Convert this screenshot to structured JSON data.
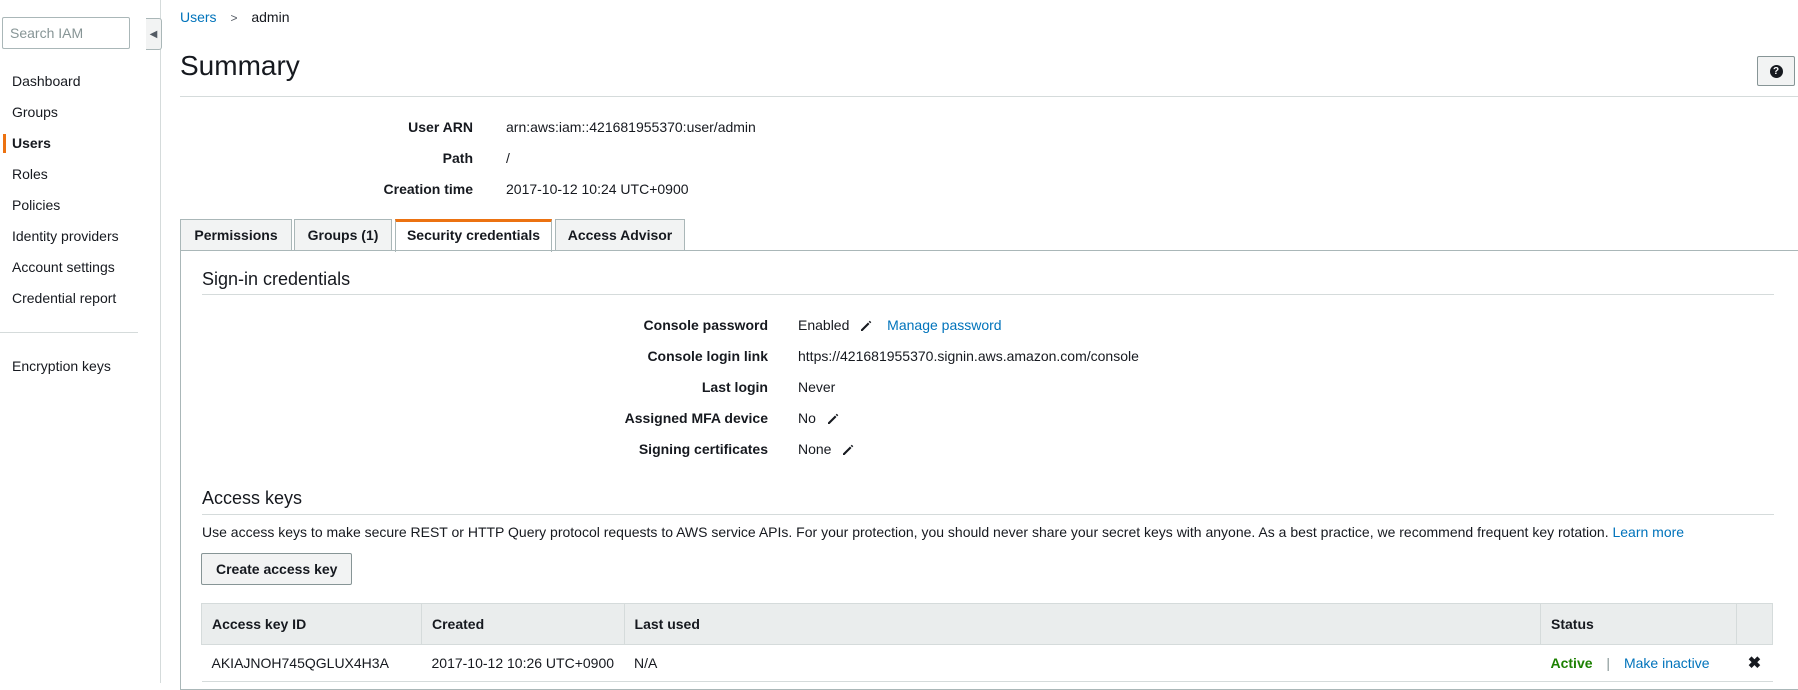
{
  "sidebar": {
    "search_placeholder": "Search IAM",
    "collapse_icon": "caret-left-icon",
    "items": [
      {
        "label": "Dashboard"
      },
      {
        "label": "Groups"
      },
      {
        "label": "Users",
        "active": true
      },
      {
        "label": "Roles"
      },
      {
        "label": "Policies"
      },
      {
        "label": "Identity providers"
      },
      {
        "label": "Account settings"
      },
      {
        "label": "Credential report"
      }
    ],
    "encryption_keys": "Encryption keys"
  },
  "breadcrumb": {
    "parent": "Users",
    "separator": ">",
    "current": "admin"
  },
  "page_title": "Summary",
  "help_icon": "question-icon",
  "summary": {
    "user_arn_label": "User ARN",
    "user_arn": "arn:aws:iam::421681955370:user/admin",
    "path_label": "Path",
    "path": "/",
    "creation_time_label": "Creation time",
    "creation_time": "2017-10-12 10:24 UTC+0900"
  },
  "tabs": [
    {
      "label": "Permissions"
    },
    {
      "label": "Groups (1)"
    },
    {
      "label": "Security credentials",
      "active": true
    },
    {
      "label": "Access Advisor"
    }
  ],
  "signin": {
    "title": "Sign-in credentials",
    "console_password_label": "Console password",
    "console_password": "Enabled",
    "manage_password": "Manage password",
    "console_login_link_label": "Console login link",
    "console_login_link": "https://421681955370.signin.aws.amazon.com/console",
    "last_login_label": "Last login",
    "last_login": "Never",
    "mfa_label": "Assigned MFA device",
    "mfa": "No",
    "signing_certs_label": "Signing certificates",
    "signing_certs": "None"
  },
  "access_keys": {
    "title": "Access keys",
    "description": "Use access keys to make secure REST or HTTP Query protocol requests to AWS service APIs. For your protection, you should never share your secret keys with anyone. As a best practice, we recommend frequent key rotation.",
    "learn_more": "Learn more",
    "create_button": "Create access key",
    "columns": {
      "id": "Access key ID",
      "created": "Created",
      "last_used": "Last used",
      "status": "Status"
    },
    "rows": [
      {
        "id": "AKIAJNOH745QGLUX4H3A",
        "created": "2017-10-12 10:26 UTC+0900",
        "last_used": "N/A",
        "status": "Active",
        "action": "Make inactive",
        "separator": "|",
        "delete_icon": "close-icon"
      }
    ]
  },
  "colors": {
    "accent": "#ec7211",
    "link": "#0073bb",
    "active_status": "#1d8102"
  }
}
